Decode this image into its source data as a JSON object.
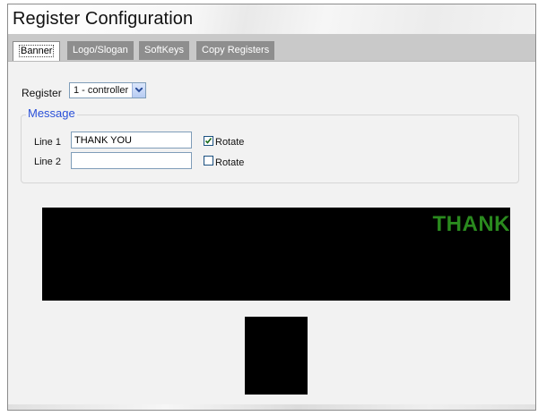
{
  "window": {
    "title": "Register Configuration"
  },
  "tabs": [
    {
      "label": "Banner",
      "active": true
    },
    {
      "label": "Logo/Slogan",
      "active": false
    },
    {
      "label": "SoftKeys",
      "active": false
    },
    {
      "label": "Copy Registers",
      "active": false
    }
  ],
  "register": {
    "label": "Register",
    "selected": "1 - controller"
  },
  "message": {
    "legend": "Message",
    "line1": {
      "label": "Line 1",
      "value": "THANK YOU",
      "rotate_label": "Rotate",
      "rotate_checked": true
    },
    "line2": {
      "label": "Line 2",
      "value": "",
      "rotate_label": "Rotate",
      "rotate_checked": false
    }
  },
  "banner_preview": {
    "text": "THANK",
    "text_color": "#2a8a1e",
    "background": "#000000"
  },
  "colors": {
    "tab_inactive": "#8e8e8e",
    "tab_bar": "#c9c9c9",
    "legend": "#2a50d8",
    "content_bg": "#f2f2f2"
  }
}
